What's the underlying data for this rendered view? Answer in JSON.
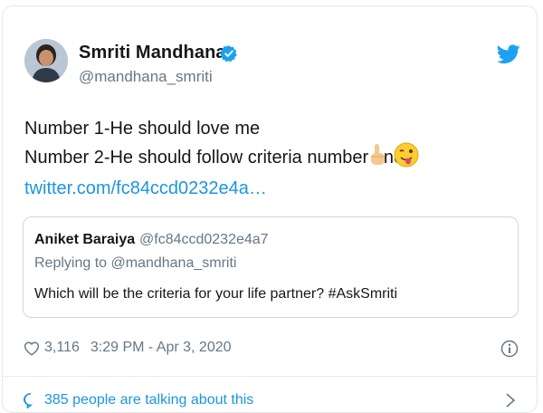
{
  "user": {
    "name": "Smriti Mandhana",
    "handle": "@mandhana_smriti",
    "avatar_icon": "profile-photo"
  },
  "tweet": {
    "line1": "Number 1-He should love me",
    "line2": "Number 2-He should follow criteria number one",
    "link": "twitter.com/fc84ccd0232e4a…"
  },
  "quoted": {
    "name": "Aniket Baraiya",
    "handle": "@fc84ccd0232e4a7",
    "replying": "Replying to @mandhana_smriti",
    "text": "Which will be the criteria for your life partner? #AskSmriti"
  },
  "footer": {
    "likes": "3,116",
    "timestamp": "3:29 PM - Apr 3, 2020",
    "talking": "385 people are talking about this"
  },
  "colors": {
    "link": "#1b95e0",
    "muted": "#657786",
    "text": "#14171a",
    "border": "#e1e8ed"
  }
}
